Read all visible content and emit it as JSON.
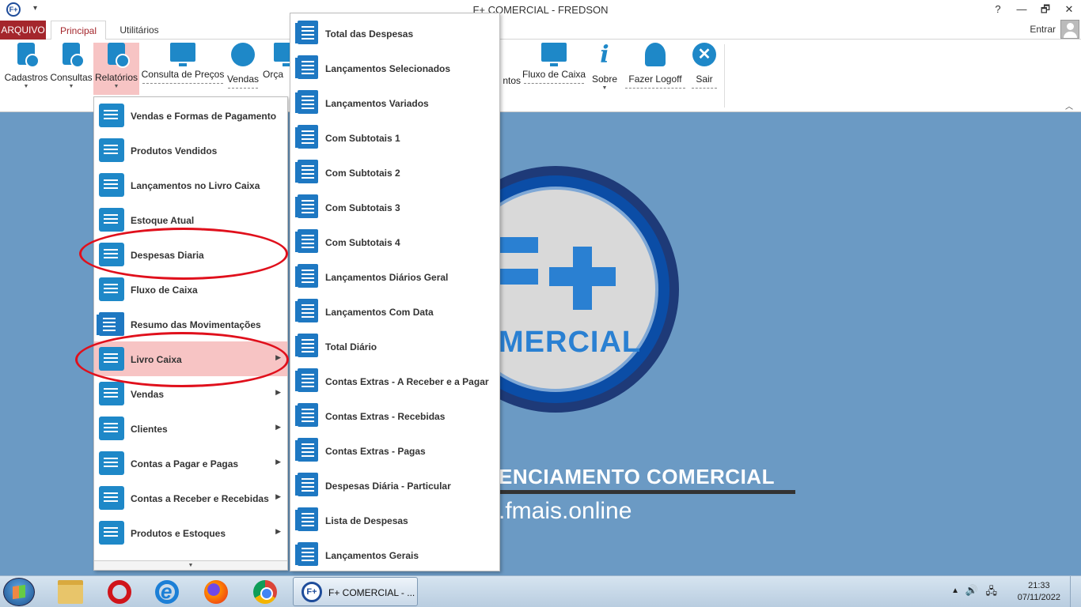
{
  "window": {
    "title": "F+ COMERCIAL - FREDSON",
    "logo_text": "F+",
    "help": "?",
    "minimize": "—",
    "restore": "🗗",
    "close": "✕"
  },
  "tabs": {
    "arquivo": "ARQUIVO",
    "principal": "Principal",
    "utilitarios": "Utilitários",
    "entrar": "Entrar"
  },
  "ribbon": {
    "cadastros": "Cadastros",
    "consultas": "Consultas",
    "relatorios": "Relatórios",
    "consulta_precos": "Consulta de Preços",
    "vendas": "Vendas",
    "orcamentos": "Orça",
    "lancamentos_partial": "ntos",
    "fluxo_caixa": "Fluxo de Caixa",
    "sobre": "Sobre",
    "fazer_logoff": "Fazer Logoff",
    "sair": "Sair"
  },
  "menu_relatorios": [
    {
      "label": "Vendas e Formas de Pagamento",
      "submenu": false
    },
    {
      "label": "Produtos Vendidos",
      "submenu": false
    },
    {
      "label": "Lançamentos no Livro Caixa",
      "submenu": false
    },
    {
      "label": "Estoque Atual",
      "submenu": false
    },
    {
      "label": "Despesas Diaria",
      "submenu": false
    },
    {
      "label": "Fluxo de Caixa",
      "submenu": false
    },
    {
      "label": "Resumo das Movimentações",
      "submenu": false
    },
    {
      "label": "Livro Caixa",
      "submenu": true
    },
    {
      "label": "Vendas",
      "submenu": true
    },
    {
      "label": "Clientes",
      "submenu": true
    },
    {
      "label": "Contas a Pagar e Pagas",
      "submenu": true
    },
    {
      "label": "Contas a Receber e Recebidas",
      "submenu": true
    },
    {
      "label": "Produtos e Estoques",
      "submenu": true
    }
  ],
  "menu_livro_caixa": [
    "Total das Despesas",
    "Lançamentos Selecionados",
    "Lançamentos Variados",
    "Com Subtotais 1",
    "Com Subtotais 2",
    "Com Subtotais 3",
    "Com Subtotais 4",
    "Lançamentos Diários Geral",
    "Lançamentos Com Data",
    "Total Diário",
    "Contas Extras - A Receber e a Pagar",
    "Contas Extras - Recebidas",
    "Contas Extras - Pagas",
    "Despesas Diária - Particular",
    "Lista de Despesas",
    "Lançamentos Gerais"
  ],
  "background": {
    "comercial": "MERCIAL",
    "tagline": "ENCIAMENTO COMERCIAL",
    "url": ".fmais.online"
  },
  "taskbar": {
    "app_label": "F+ COMERCIAL - ...",
    "app_logo": "F+",
    "time": "21:33",
    "date": "07/11/2022"
  },
  "colors": {
    "accent": "#a4262c",
    "highlight": "#f7c4c4",
    "icon_blue": "#1e88c8",
    "desktop": "#6b9ac4",
    "annotation": "#e0101c"
  }
}
